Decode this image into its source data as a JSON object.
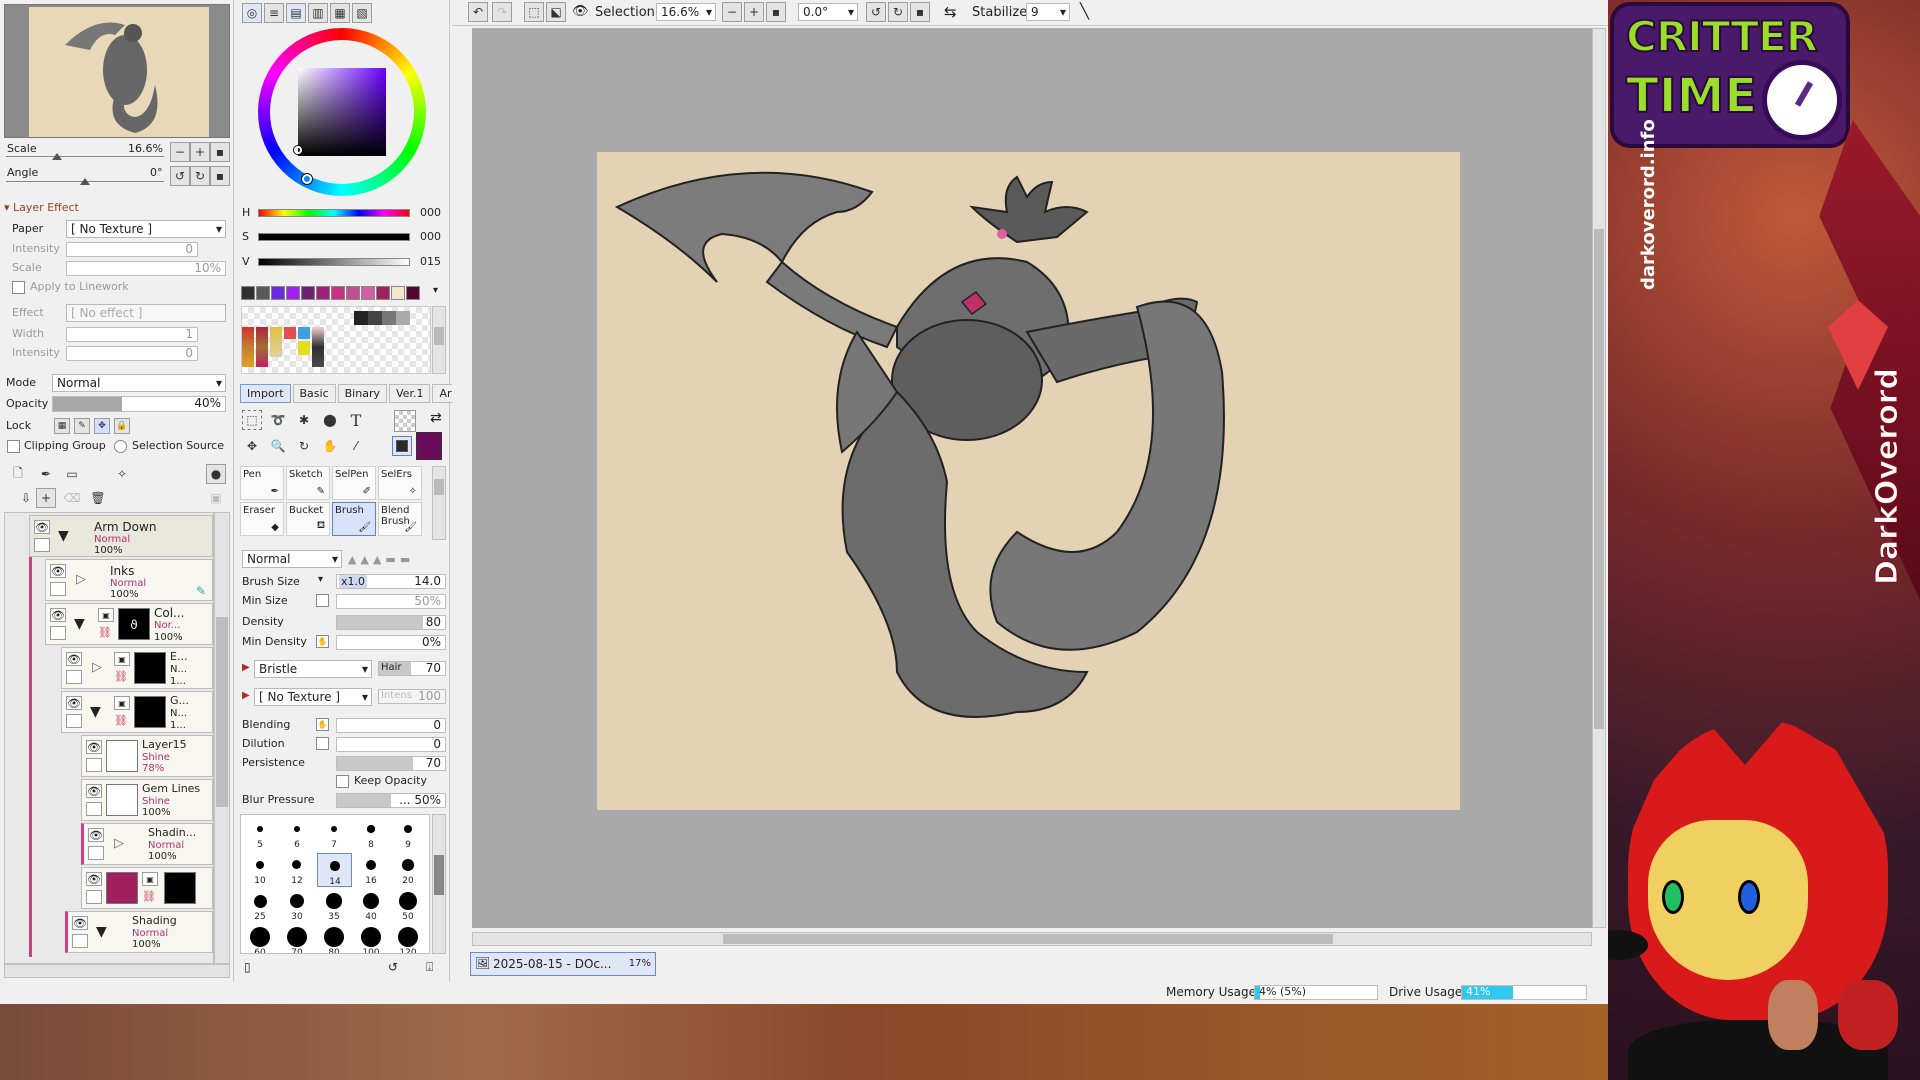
{
  "navigator": {
    "scale_label": "Scale",
    "scale_value": "16.6%",
    "angle_label": "Angle",
    "angle_value": "0°"
  },
  "layer_effect": {
    "header": "Layer Effect",
    "paper_label": "Paper",
    "paper_value": "[ No Texture ]",
    "intensity_label": "Intensity",
    "intensity_value": "0",
    "scale_label": "Scale",
    "scale_value": "10%",
    "apply_linework": "Apply to Linework",
    "effect_label": "Effect",
    "effect_value": "[ No effect ]",
    "width_label": "Width",
    "width_value": "1",
    "intensity2_label": "Intensity",
    "intensity2_value": "0"
  },
  "layer_props": {
    "mode_label": "Mode",
    "mode_value": "Normal",
    "opacity_label": "Opacity",
    "opacity_value": "40%",
    "opacity_fraction": 0.4,
    "lock_label": "Lock",
    "clipping_group": "Clipping Group",
    "selection_source": "Selection Source"
  },
  "layers": [
    {
      "name": "Arm Down",
      "mode": "Normal",
      "opacity": "100%"
    },
    {
      "name": "Inks",
      "mode": "Normal",
      "opacity": "100%"
    },
    {
      "name": "Col...",
      "mode": "Nor...",
      "opacity": "100%"
    },
    {
      "name": "E...",
      "mode": "N...",
      "opacity": "1..."
    },
    {
      "name": "G...",
      "mode": "N...",
      "opacity": "1..."
    },
    {
      "name": "Layer15",
      "mode": "Shine",
      "opacity": "78%"
    },
    {
      "name": "Gem Lines",
      "mode": "Shine",
      "opacity": "100%"
    },
    {
      "name": "Shadin...",
      "mode": "Normal",
      "opacity": "100%"
    },
    {
      "name": "Shading",
      "mode": "Normal",
      "opacity": "100%"
    }
  ],
  "color": {
    "h_label": "H",
    "h_value": "000",
    "s_label": "S",
    "s_value": "000",
    "v_label": "V",
    "v_value": "015",
    "primary": "#2a2a2a",
    "secondary": "#6a0a5a",
    "swatches": [
      "#303030",
      "#5a5a5a",
      "#6a2ae0",
      "#a020f0",
      "#702070",
      "#a02080",
      "#c83080",
      "#c05090",
      "#d060a0",
      "#a02060",
      "#f0e8c8",
      "#500a30"
    ]
  },
  "tool_tabs": [
    "Import",
    "Basic",
    "Binary",
    "Ver.1",
    "Artistic"
  ],
  "tools": [
    {
      "name": "Pen"
    },
    {
      "name": "Sketch"
    },
    {
      "name": "SelPen"
    },
    {
      "name": "SelErs"
    },
    {
      "name": "Eraser"
    },
    {
      "name": "Bucket"
    },
    {
      "name": "Brush"
    },
    {
      "name": "Blend Brush"
    }
  ],
  "brush": {
    "blend_mode": "Normal",
    "size_label": "Brush Size",
    "size_mult": "x1.0",
    "size_value": "14.0",
    "min_size_label": "Min Size",
    "min_size_value": "50%",
    "density_label": "Density",
    "density_value": "80",
    "min_density_label": "Min Density",
    "min_density_value": "0%",
    "shape": "Bristle",
    "shape_param": "Hair",
    "shape_param_value": "70",
    "texture": "[ No Texture ]",
    "texture_param": "Intens",
    "texture_param_value": "100",
    "blending_label": "Blending",
    "blending_value": "0",
    "dilution_label": "Dilution",
    "dilution_value": "0",
    "persistence_label": "Persistence",
    "persistence_value": "70",
    "keep_opacity": "Keep Opacity",
    "blur_label": "Blur Pressure",
    "blur_value": "... 50%"
  },
  "brush_sizes": [
    "5",
    "6",
    "7",
    "8",
    "9",
    "10",
    "12",
    "14",
    "16",
    "20",
    "25",
    "30",
    "35",
    "40",
    "50",
    "60",
    "70",
    "80",
    "100",
    "120"
  ],
  "toolbar": {
    "selection_label": "Selection",
    "zoom": "16.6%",
    "rotation": "0.0°",
    "stabilizer_label": "Stabilizer",
    "stabilizer_value": "9"
  },
  "document_tab": {
    "name": "2025-08-15 - DOc...",
    "zoom": "17%"
  },
  "status": {
    "memory_label": "Memory Usage",
    "memory_value": "4% (5%)",
    "drive_label": "Drive Usage",
    "drive_value": "41%"
  },
  "overlay": {
    "logo_line1": "CRITTER",
    "logo_line2": "TIME",
    "site": "darkoverord.info",
    "name": "DarkOverord"
  }
}
